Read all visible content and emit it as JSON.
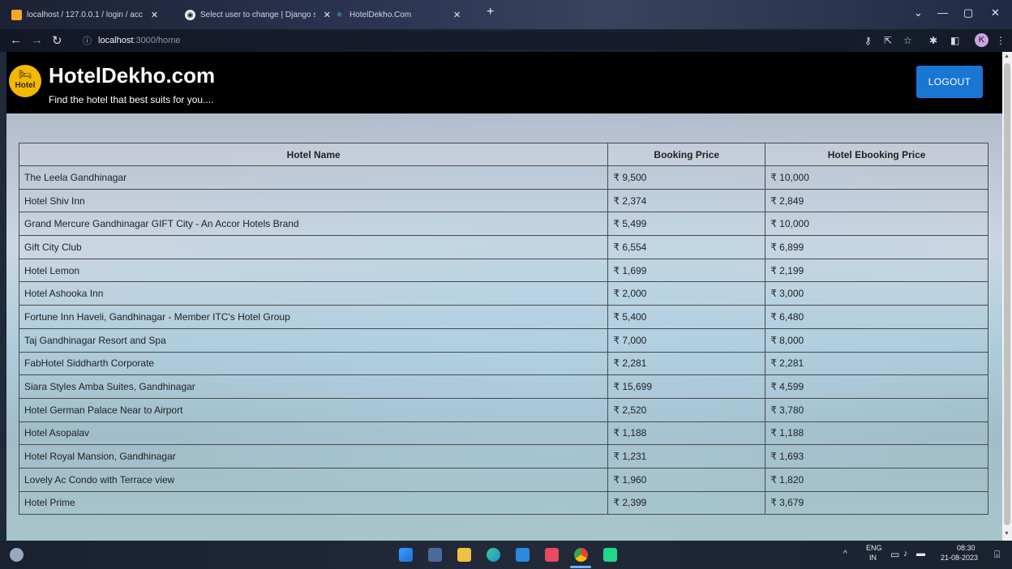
{
  "browser": {
    "tabs": [
      {
        "title": "localhost / 127.0.0.1 / login / acc"
      },
      {
        "title": "Select user to change | Django si"
      },
      {
        "title": "HotelDekho.Com"
      }
    ],
    "url_host": "localhost",
    "url_path": ":3000/home",
    "profile_initial": "K"
  },
  "header": {
    "logo_text": "Hotel",
    "title": "HotelDekho.com",
    "tagline": "Find the hotel that best suits for you....",
    "logout_label": "LOGOUT"
  },
  "table": {
    "columns": [
      "Hotel Name",
      "Booking Price",
      "Hotel Ebooking Price"
    ],
    "rows": [
      [
        "The Leela Gandhinagar",
        "₹ 9,500",
        "₹ 10,000"
      ],
      [
        "Hotel Shiv Inn",
        "₹ 2,374",
        "₹ 2,849"
      ],
      [
        "Grand Mercure Gandhinagar GIFT City - An Accor Hotels Brand",
        "₹ 5,499",
        "₹ 10,000"
      ],
      [
        "Gift City Club",
        "₹ 6,554",
        "₹ 6,899"
      ],
      [
        "Hotel Lemon",
        "₹ 1,699",
        "₹ 2,199"
      ],
      [
        "Hotel Ashooka Inn",
        "₹ 2,000",
        "₹ 3,000"
      ],
      [
        "Fortune Inn Haveli, Gandhinagar - Member ITC's Hotel Group",
        "₹ 5,400",
        "₹ 6,480"
      ],
      [
        "Taj Gandhinagar Resort and Spa",
        "₹ 7,000",
        "₹ 8,000"
      ],
      [
        "FabHotel Siddharth Corporate",
        "₹ 2,281",
        "₹ 2,281"
      ],
      [
        "Siara Styles Amba Suites, Gandhinagar",
        "₹ 15,699",
        "₹ 4,599"
      ],
      [
        "Hotel German Palace Near to Airport",
        "₹ 2,520",
        "₹ 3,780"
      ],
      [
        "Hotel Asopalav",
        "₹ 1,188",
        "₹ 1,188"
      ],
      [
        "Hotel Royal Mansion, Gandhinagar",
        "₹ 1,231",
        "₹ 1,693"
      ],
      [
        "Lovely Ac Condo with Terrace view",
        "₹ 1,960",
        "₹ 1,820"
      ],
      [
        "Hotel Prime",
        "₹ 2,399",
        "₹ 3,679"
      ]
    ]
  },
  "taskbar": {
    "lang_top": "ENG",
    "lang_bottom": "IN",
    "time": "08:30",
    "date": "21-08-2023",
    "apps": [
      "start-icon",
      "store-icon",
      "file-explorer-icon",
      "edge-icon",
      "vscode-icon",
      "office-icon",
      "chrome-icon",
      "pycharm-icon"
    ]
  }
}
